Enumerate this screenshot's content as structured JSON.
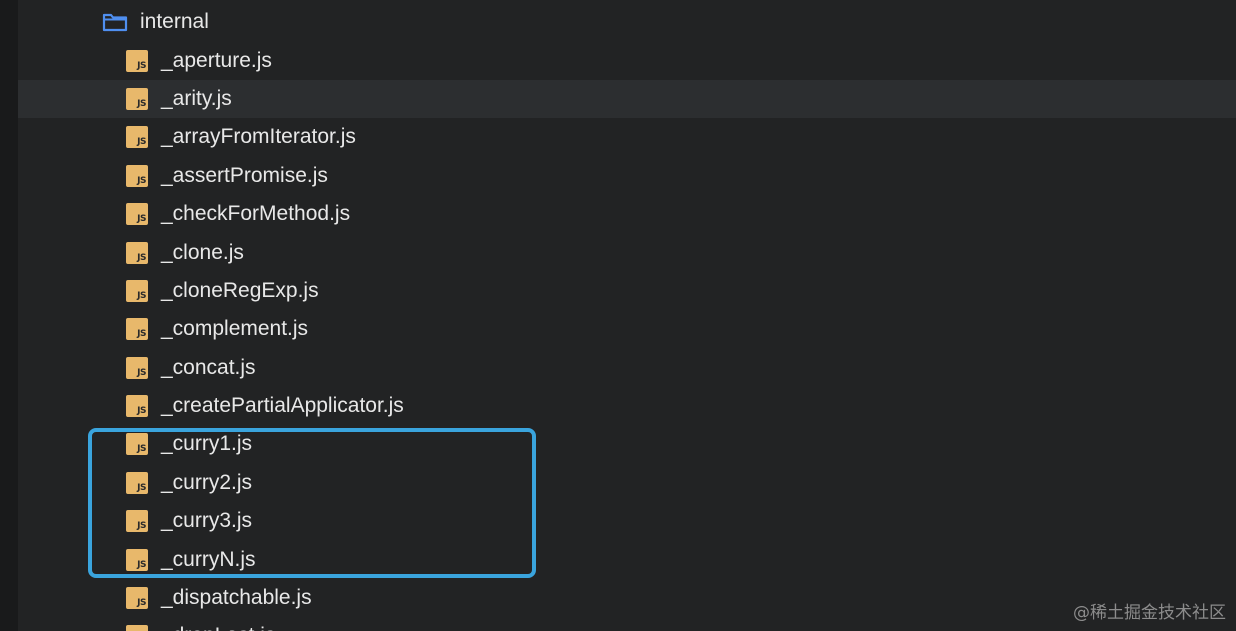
{
  "folder": {
    "name": "internal",
    "icon": "folder-icon",
    "icon_color": "#4f8ff0"
  },
  "files": [
    {
      "name": "_aperture.js",
      "selected": false
    },
    {
      "name": "_arity.js",
      "selected": true
    },
    {
      "name": "_arrayFromIterator.js",
      "selected": false
    },
    {
      "name": "_assertPromise.js",
      "selected": false
    },
    {
      "name": "_checkForMethod.js",
      "selected": false
    },
    {
      "name": "_clone.js",
      "selected": false
    },
    {
      "name": "_cloneRegExp.js",
      "selected": false
    },
    {
      "name": "_complement.js",
      "selected": false
    },
    {
      "name": "_concat.js",
      "selected": false
    },
    {
      "name": "_createPartialApplicator.js",
      "selected": false
    },
    {
      "name": "_curry1.js",
      "selected": false
    },
    {
      "name": "_curry2.js",
      "selected": false
    },
    {
      "name": "_curry3.js",
      "selected": false
    },
    {
      "name": "_curryN.js",
      "selected": false
    },
    {
      "name": "_dispatchable.js",
      "selected": false
    },
    {
      "name": "_dropLast.js",
      "selected": false
    }
  ],
  "file_icon": {
    "name": "js-file-icon",
    "text": "JS",
    "color": "#e8b86b"
  },
  "highlight": {
    "color": "#3aa4dd",
    "files": [
      "_curry1.js",
      "_curry2.js",
      "_curry3.js",
      "_curryN.js"
    ]
  },
  "watermark": "@稀土掘金技术社区",
  "colors": {
    "background": "#222324",
    "selected_row": "#2c2e30",
    "text": "#e8e8e8"
  }
}
